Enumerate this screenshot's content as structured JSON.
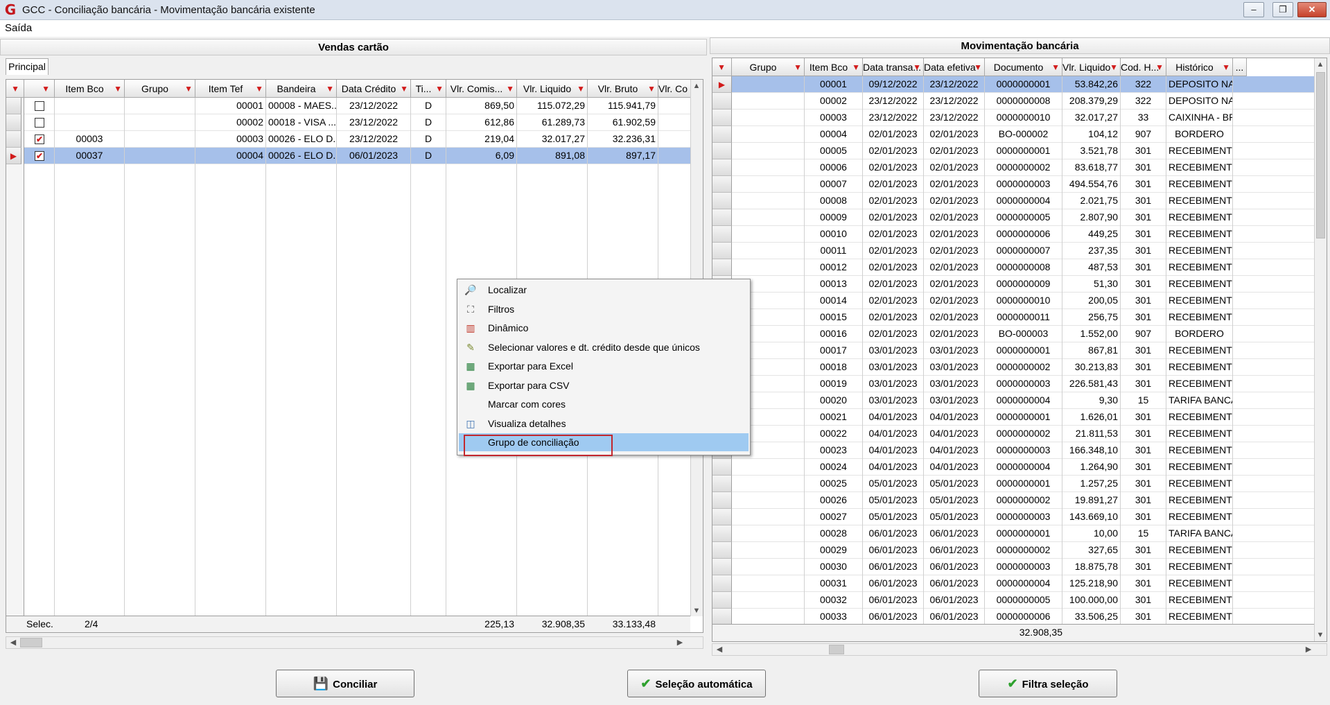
{
  "window": {
    "title": "GCC - Conciliação bancária - Movimentação bancária existente",
    "logo": "G",
    "min": "–",
    "restore": "❐",
    "close": "✕"
  },
  "menu": {
    "saida": "Saída"
  },
  "left": {
    "title": "Vendas cartão",
    "tab": "Principal",
    "columns": [
      "Item Bco",
      "Grupo",
      "Item Tef",
      "Bandeira",
      "Data Crédito",
      "Ti...",
      "Vlr. Comis...",
      "Vlr. Liquido",
      "Vlr. Bruto",
      "Vlr. Co"
    ],
    "rows": [
      {
        "checked": false,
        "item_bco": "",
        "grupo": "",
        "item_tef": "00001",
        "bandeira": "00008 - MAES...",
        "data": "23/12/2022",
        "ti": "D",
        "comis": "869,50",
        "liquido": "115.072,29",
        "bruto": "115.941,79"
      },
      {
        "checked": false,
        "item_bco": "",
        "grupo": "",
        "item_tef": "00002",
        "bandeira": "00018 - VISA ...",
        "data": "23/12/2022",
        "ti": "D",
        "comis": "612,86",
        "liquido": "61.289,73",
        "bruto": "61.902,59"
      },
      {
        "checked": true,
        "item_bco": "00003",
        "grupo": "",
        "item_tef": "00003",
        "bandeira": "00026 - ELO D...",
        "data": "23/12/2022",
        "ti": "D",
        "comis": "219,04",
        "liquido": "32.017,27",
        "bruto": "32.236,31"
      },
      {
        "checked": true,
        "item_bco": "00037",
        "grupo": "",
        "item_tef": "00004",
        "bandeira": "00026 - ELO D...",
        "data": "06/01/2023",
        "ti": "D",
        "comis": "6,09",
        "liquido": "891,08",
        "bruto": "897,17"
      }
    ],
    "footer": {
      "label": "Selec.",
      "count": "2/4",
      "comis": "225,13",
      "liquido": "32.908,35",
      "bruto": "33.133,48"
    }
  },
  "right": {
    "title": "Movimentação bancária",
    "columns": [
      "Grupo",
      "Item Bco",
      "Data transa...",
      "Data efetiva",
      "Documento",
      "Vlr. Liquido",
      "Cod. H...",
      "Histórico",
      "..."
    ],
    "rows": [
      [
        "00001",
        "09/12/2022",
        "23/12/2022",
        "0000000001",
        "53.842,26",
        "322",
        "DEPOSITO NAO..."
      ],
      [
        "00002",
        "23/12/2022",
        "23/12/2022",
        "0000000008",
        "208.379,29",
        "322",
        "DEPOSITO NAO..."
      ],
      [
        "00003",
        "23/12/2022",
        "23/12/2022",
        "0000000010",
        "32.017,27",
        "33",
        "CAIXINHA - BRI..."
      ],
      [
        "00004",
        "02/01/2023",
        "02/01/2023",
        "BO-000002",
        "104,12",
        "907",
        "BORDERO"
      ],
      [
        "00005",
        "02/01/2023",
        "02/01/2023",
        "0000000001",
        "3.521,78",
        "301",
        "RECEBIMENTO ..."
      ],
      [
        "00006",
        "02/01/2023",
        "02/01/2023",
        "0000000002",
        "83.618,77",
        "301",
        "RECEBIMENTO ..."
      ],
      [
        "00007",
        "02/01/2023",
        "02/01/2023",
        "0000000003",
        "494.554,76",
        "301",
        "RECEBIMENTO ..."
      ],
      [
        "00008",
        "02/01/2023",
        "02/01/2023",
        "0000000004",
        "2.021,75",
        "301",
        "RECEBIMENTO ..."
      ],
      [
        "00009",
        "02/01/2023",
        "02/01/2023",
        "0000000005",
        "2.807,90",
        "301",
        "RECEBIMENTO ..."
      ],
      [
        "00010",
        "02/01/2023",
        "02/01/2023",
        "0000000006",
        "449,25",
        "301",
        "RECEBIMENTO ..."
      ],
      [
        "00011",
        "02/01/2023",
        "02/01/2023",
        "0000000007",
        "237,35",
        "301",
        "RECEBIMENTO ..."
      ],
      [
        "00012",
        "02/01/2023",
        "02/01/2023",
        "0000000008",
        "487,53",
        "301",
        "RECEBIMENTO ..."
      ],
      [
        "00013",
        "02/01/2023",
        "02/01/2023",
        "0000000009",
        "51,30",
        "301",
        "RECEBIMENTO ..."
      ],
      [
        "00014",
        "02/01/2023",
        "02/01/2023",
        "0000000010",
        "200,05",
        "301",
        "RECEBIMENTO ..."
      ],
      [
        "00015",
        "02/01/2023",
        "02/01/2023",
        "0000000011",
        "256,75",
        "301",
        "RECEBIMENTO ..."
      ],
      [
        "00016",
        "02/01/2023",
        "02/01/2023",
        "BO-000003",
        "1.552,00",
        "907",
        "BORDERO"
      ],
      [
        "00017",
        "03/01/2023",
        "03/01/2023",
        "0000000001",
        "867,81",
        "301",
        "RECEBIMENTO ..."
      ],
      [
        "00018",
        "03/01/2023",
        "03/01/2023",
        "0000000002",
        "30.213,83",
        "301",
        "RECEBIMENTO ..."
      ],
      [
        "00019",
        "03/01/2023",
        "03/01/2023",
        "0000000003",
        "226.581,43",
        "301",
        "RECEBIMENTO ..."
      ],
      [
        "00020",
        "03/01/2023",
        "03/01/2023",
        "0000000004",
        "9,30",
        "15",
        "TARIFA BANCA..."
      ],
      [
        "00021",
        "04/01/2023",
        "04/01/2023",
        "0000000001",
        "1.626,01",
        "301",
        "RECEBIMENTO ..."
      ],
      [
        "00022",
        "04/01/2023",
        "04/01/2023",
        "0000000002",
        "21.811,53",
        "301",
        "RECEBIMENTO ..."
      ],
      [
        "00023",
        "04/01/2023",
        "04/01/2023",
        "0000000003",
        "166.348,10",
        "301",
        "RECEBIMENTO ..."
      ],
      [
        "00024",
        "04/01/2023",
        "04/01/2023",
        "0000000004",
        "1.264,90",
        "301",
        "RECEBIMENTO ..."
      ],
      [
        "00025",
        "05/01/2023",
        "05/01/2023",
        "0000000001",
        "1.257,25",
        "301",
        "RECEBIMENTO ..."
      ],
      [
        "00026",
        "05/01/2023",
        "05/01/2023",
        "0000000002",
        "19.891,27",
        "301",
        "RECEBIMENTO ..."
      ],
      [
        "00027",
        "05/01/2023",
        "05/01/2023",
        "0000000003",
        "143.669,10",
        "301",
        "RECEBIMENTO ..."
      ],
      [
        "00028",
        "06/01/2023",
        "06/01/2023",
        "0000000001",
        "10,00",
        "15",
        "TARIFA BANCA..."
      ],
      [
        "00029",
        "06/01/2023",
        "06/01/2023",
        "0000000002",
        "327,65",
        "301",
        "RECEBIMENTO ..."
      ],
      [
        "00030",
        "06/01/2023",
        "06/01/2023",
        "0000000003",
        "18.875,78",
        "301",
        "RECEBIMENTO ..."
      ],
      [
        "00031",
        "06/01/2023",
        "06/01/2023",
        "0000000004",
        "125.218,90",
        "301",
        "RECEBIMENTO ..."
      ],
      [
        "00032",
        "06/01/2023",
        "06/01/2023",
        "0000000005",
        "100.000,00",
        "301",
        "RECEBIMENTO ..."
      ],
      [
        "00033",
        "06/01/2023",
        "06/01/2023",
        "0000000006",
        "33.506,25",
        "301",
        "RECEBIMENTO ..."
      ]
    ],
    "footer": {
      "liquido": "32.908,35"
    }
  },
  "context_menu": [
    {
      "label": "Localizar",
      "icon": "search-icon",
      "glyph": "🔎"
    },
    {
      "label": "Filtros",
      "icon": "binoculars-icon",
      "glyph": "⛶"
    },
    {
      "label": "Dinâmico",
      "icon": "chart-icon",
      "glyph": "▥"
    },
    {
      "label": "Selecionar valores e dt. crédito desde que únicos",
      "icon": "select-values-icon",
      "glyph": "✎"
    },
    {
      "label": "Exportar para Excel",
      "icon": "excel-icon",
      "glyph": "▦"
    },
    {
      "label": "Exportar para CSV",
      "icon": "csv-icon",
      "glyph": "▦"
    },
    {
      "label": "Marcar com cores",
      "icon": "",
      "glyph": ""
    },
    {
      "label": "Visualiza detalhes",
      "icon": "details-icon",
      "glyph": "◫"
    },
    {
      "label": "Grupo de conciliação",
      "icon": "",
      "glyph": ""
    }
  ],
  "buttons": {
    "conciliar": "Conciliar",
    "selecao_auto": "Seleção automática",
    "filtra": "Filtra seleção"
  },
  "colors": {
    "selection": "#a6c0ea",
    "filter_red": "#d21b1b",
    "highlight": "#9fcaf1",
    "annotation_red": "#c2272d"
  }
}
